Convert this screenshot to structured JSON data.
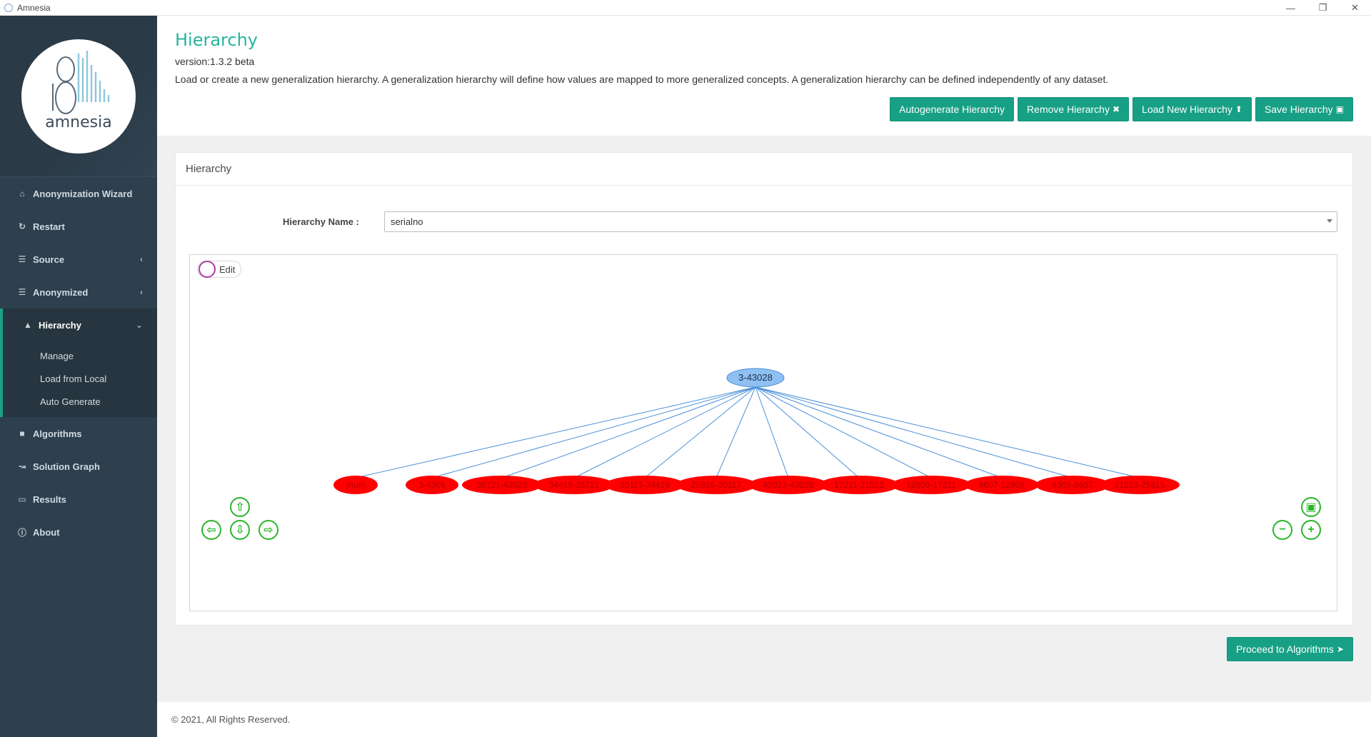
{
  "window": {
    "title": "Amnesia",
    "minimize": "—",
    "maximize": "❐",
    "close": "✕"
  },
  "sidebar": {
    "logo_text": "amnesia",
    "items": [
      {
        "label": "Anonymization Wizard",
        "icon": "home-icon"
      },
      {
        "label": "Restart",
        "icon": "refresh-icon"
      },
      {
        "label": "Source",
        "icon": "database-icon",
        "chevron": "‹"
      },
      {
        "label": "Anonymized",
        "icon": "database-icon",
        "chevron": "‹"
      },
      {
        "label": "Hierarchy",
        "icon": "sitemap-icon",
        "chevron": "⌄"
      },
      {
        "label": "Algorithms",
        "icon": "lock-icon"
      },
      {
        "label": "Solution Graph",
        "icon": "line-chart-icon"
      },
      {
        "label": "Results",
        "icon": "laptop-icon"
      },
      {
        "label": "About",
        "icon": "info-icon"
      }
    ],
    "hierarchy_sub": [
      "Manage",
      "Load from Local",
      "Auto Generate"
    ]
  },
  "header": {
    "title": "Hierarchy",
    "version": "version:1.3.2 beta",
    "description": "Load or create a new generalization hierarchy. A generalization hierarchy will define how values are mapped to more generalized concepts. A generalization hierarchy can be defined independently of any dataset.",
    "buttons": {
      "autogenerate": "Autogenerate Hierarchy",
      "remove": "Remove Hierarchy",
      "load": "Load New Hierarchy",
      "save": "Save Hierarchy"
    }
  },
  "panel": {
    "title": "Hierarchy",
    "name_label": "Hierarchy Name :",
    "name_value": "serialno",
    "edit_label": "Edit"
  },
  "graph": {
    "root": "3-43028",
    "children": [
      "(null)",
      "3-4305",
      "38721-43023",
      "34419-38721",
      "30117-34419",
      "25815-30117",
      "43023-43028",
      "17211-21513",
      "12909-17211",
      "8607-12909",
      "4305-8607",
      "21513-25815"
    ],
    "root_color": "#8ec0f2",
    "child_color": "#ff0000",
    "edge_color": "#4a90d9"
  },
  "proceed_label": "Proceed to Algorithms",
  "footer": "© 2021, All Rights Reserved."
}
